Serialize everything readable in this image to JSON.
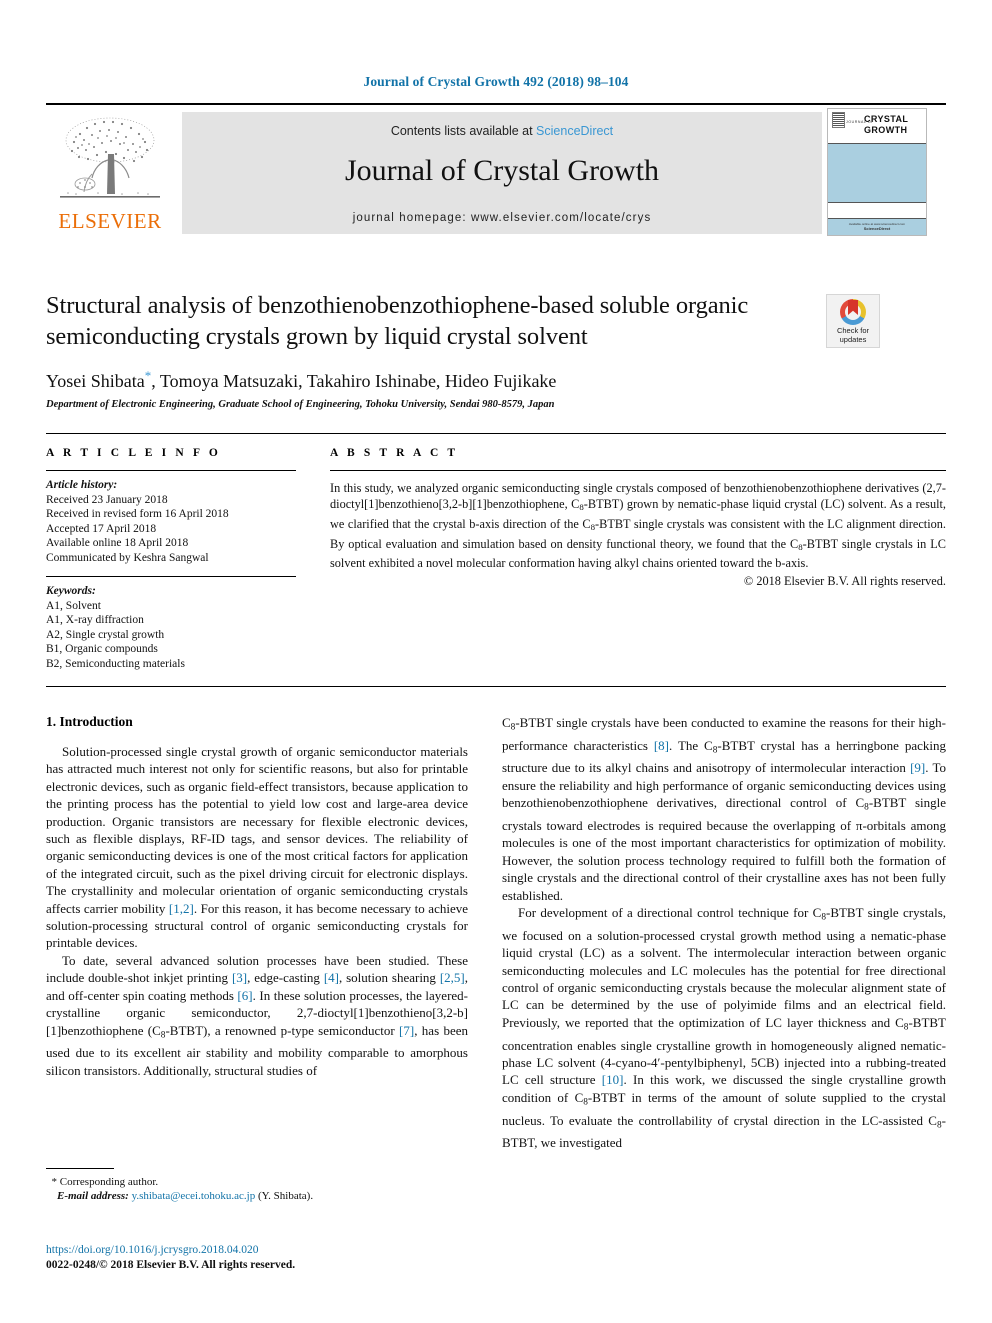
{
  "running_head": "Journal of Crystal Growth 492 (2018) 98–104",
  "masthead": {
    "contents_prefix": "Contents lists available at ",
    "sciencedirect": "ScienceDirect",
    "journal_title": "Journal of Crystal Growth",
    "homepage": "journal homepage: www.elsevier.com/locate/crys",
    "publisher_name": "ELSEVIER",
    "cover": {
      "journal_of": "JOURNAL OF",
      "title_line1": "CRYSTAL",
      "title_line2": "GROWTH",
      "foot_line1": "Available online at www.sciencedirect.com",
      "foot_line2": "ScienceDirect"
    }
  },
  "article": {
    "title": "Structural analysis of benzothienobenzothiophene-based soluble organic semiconducting crystals grown by liquid crystal solvent",
    "authors": "Yosei Shibata",
    "corresponding_marker": "*",
    "authors_rest": ", Tomoya Matsuzaki, Takahiro Ishinabe, Hideo Fujikake",
    "affiliation": "Department of Electronic Engineering, Graduate School of Engineering, Tohoku University, Sendai 980-8579, Japan"
  },
  "crossmark": {
    "line1": "Check for",
    "line2": "updates"
  },
  "article_info": {
    "heading": "A R T I C L E    I N F O",
    "history_label": "Article history:",
    "history": [
      "Received 23 January 2018",
      "Received in revised form 16 April 2018",
      "Accepted 17 April 2018",
      "Available online 18 April 2018",
      "Communicated by Keshra Sangwal"
    ],
    "keywords_label": "Keywords:",
    "keywords": [
      "A1, Solvent",
      "A1, X-ray diffraction",
      "A2, Single crystal growth",
      "B1, Organic compounds",
      "B2, Semiconducting materials"
    ]
  },
  "abstract": {
    "heading": "A B S T R A C T",
    "text_1": "In this study, we analyzed organic semiconducting single crystals composed of benzothienobenzothiophene derivatives (2,7-dioctyl[1]benzothieno[3,2-b][1]benzothiophene, C",
    "sub_1": "8",
    "text_2": "-BTBT) grown by nematic-phase liquid crystal (LC) solvent. As a result, we clarified that the crystal b-axis direction of the C",
    "sub_2": "8",
    "text_3": "-BTBT single crystals was consistent with the LC alignment direction. By optical evaluation and simulation based on density functional theory, we found that the C",
    "sub_3": "8",
    "text_4": "-BTBT single crystals in LC solvent exhibited a novel molecular conformation having alkyl chains oriented toward the b-axis.",
    "copyright": "© 2018 Elsevier B.V. All rights reserved."
  },
  "body": {
    "section_heading": "1. Introduction",
    "left": {
      "p1_a": "Solution-processed single crystal growth of organic semiconductor materials has attracted much interest not only for scientific reasons, but also for printable electronic devices, such as organic field-effect transistors, because application to the printing process has the potential to yield low cost and large-area device production. Organic transistors are necessary for flexible electronic devices, such as flexible displays, RF-ID tags, and sensor devices. The reliability of organic semiconducting devices is one of the most critical factors for application of the integrated circuit, such as the pixel driving circuit for electronic displays. The crystallinity and molecular orientation of organic semiconducting crystals affects carrier mobility ",
      "p1_ref": "[1,2]",
      "p1_b": ". For this reason, it has become necessary to achieve solution-processing structural control of organic semiconducting crystals for printable devices.",
      "p2_a": "To date, several advanced solution processes have been studied. These include double-shot inkjet printing ",
      "p2_ref1": "[3]",
      "p2_b": ", edge-casting ",
      "p2_ref2": "[4]",
      "p2_c": ", solution shearing ",
      "p2_ref3": "[2,5]",
      "p2_d": ", and off-center spin coating methods ",
      "p2_ref4": "[6]",
      "p2_e": ". In these solution processes, the layered-crystalline organic semiconductor,      2,7-dioctyl[1]benzothieno[3,2-b][1]benzothiophene (C",
      "p2_sub": "8",
      "p2_f": "-BTBT), a renowned p-type semiconductor ",
      "p2_ref5": "[7]",
      "p2_g": ", has been used due to its excellent air stability and mobility comparable to amorphous silicon transistors. Additionally, structural studies of"
    },
    "right": {
      "p1_pre_sub": "C",
      "p1_sub": "8",
      "p1_a": "-BTBT single crystals have been conducted to examine the reasons for their high-performance characteristics ",
      "p1_ref1": "[8]",
      "p1_b": ". The C",
      "p1_sub2": "8",
      "p1_c": "-BTBT crystal has a herringbone packing structure due to its alkyl chains and anisotropy of intermolecular interaction ",
      "p1_ref2": "[9]",
      "p1_d": ". To ensure the reliability and high performance of organic semiconducting devices using benzothienobenzothiophene derivatives, directional control of C",
      "p1_sub3": "8",
      "p1_e": "-BTBT single crystals toward electrodes is required because the overlapping of π-orbitals among molecules is one of the most important characteristics for optimization of mobility. However, the solution process technology required to fulfill both the formation of single crystals and the directional control of their crystalline axes has not been fully established.",
      "p2_a": "For development of a directional control technique for C",
      "p2_sub1": "8",
      "p2_b": "-BTBT single crystals, we focused on a solution-processed crystal growth method using a nematic-phase liquid crystal (LC) as a solvent. The intermolecular interaction between organic semiconducting molecules and LC molecules has the potential for free directional control of organic semiconducting crystals because the molecular alignment state of LC can be determined by the use of polyimide films and an electrical field. Previously, we reported that the optimization of LC layer thickness and C",
      "p2_sub2": "8",
      "p2_c": "-BTBT concentration enables single crystalline growth in homogeneously aligned nematic-phase LC solvent (4-cyano-4′-pentylbiphenyl, 5CB) injected into a rubbing-treated LC cell structure ",
      "p2_ref1": "[10]",
      "p2_d": ". In this work, we discussed the single crystalline growth condition of C",
      "p2_sub3": "8",
      "p2_e": "-BTBT in terms of the amount of solute supplied to the crystal nucleus. To evaluate the controllability of crystal direction in the LC-assisted C",
      "p2_sub4": "8",
      "p2_f": "-BTBT, we investigated"
    }
  },
  "footnote": {
    "star": "*",
    "corresponding": "Corresponding author.",
    "email_label": "E-mail address:",
    "email": "y.shibata@ecei.tohoku.ac.jp",
    "email_suffix": "(Y. Shibata)."
  },
  "footer": {
    "doi": "https://doi.org/10.1016/j.jcrysgro.2018.04.020",
    "issn": "0022-0248/© 2018 Elsevier B.V. All rights reserved."
  },
  "colors": {
    "link_blue": "#1273a8",
    "sciencedirect_blue": "#3a97d3",
    "elsevier_orange": "#eb6e08",
    "band_grey": "#e3e3e3",
    "cover_blue": "#aacfe0"
  }
}
